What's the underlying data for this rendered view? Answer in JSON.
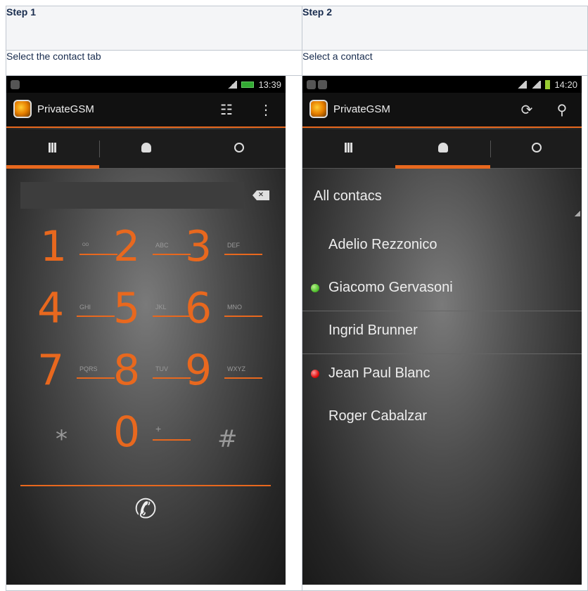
{
  "headers": [
    "Step 1",
    "Step 2"
  ],
  "descriptions": [
    "Select the contact tab",
    "Select a contact"
  ],
  "colors": {
    "accent": "#e8681e",
    "online": "#55c232",
    "busy": "#e01010"
  },
  "phone1": {
    "status_time": "13:39",
    "app_title": "PrivateGSM",
    "tabs": [
      "keypad-icon",
      "contacts-icon",
      "history-icon"
    ],
    "selected_tab": 0,
    "keys": [
      {
        "digit": "1",
        "letters": "ᴼᴼ"
      },
      {
        "digit": "2",
        "letters": "ABC"
      },
      {
        "digit": "3",
        "letters": "DEF"
      },
      {
        "digit": "4",
        "letters": "GHI"
      },
      {
        "digit": "5",
        "letters": "JKL"
      },
      {
        "digit": "6",
        "letters": "MNO"
      },
      {
        "digit": "7",
        "letters": "PQRS"
      },
      {
        "digit": "8",
        "letters": "TUV"
      },
      {
        "digit": "9",
        "letters": "WXYZ"
      },
      {
        "digit": "*",
        "letters": ""
      },
      {
        "digit": "0",
        "letters": "+"
      },
      {
        "digit": "#",
        "letters": ""
      }
    ],
    "backspace": "✕",
    "call_icon": "✆"
  },
  "phone2": {
    "status_time": "14:20",
    "app_title": "PrivateGSM",
    "selected_tab": 1,
    "group_label": "All contacs",
    "contacts": [
      {
        "name": "Adelio Rezzonico",
        "status": "none"
      },
      {
        "name": "Giacomo Gervasoni",
        "status": "online"
      },
      {
        "name": "Ingrid Brunner",
        "status": "none"
      },
      {
        "name": "Jean Paul Blanc",
        "status": "busy"
      },
      {
        "name": "Roger Cabalzar",
        "status": "none"
      }
    ]
  }
}
